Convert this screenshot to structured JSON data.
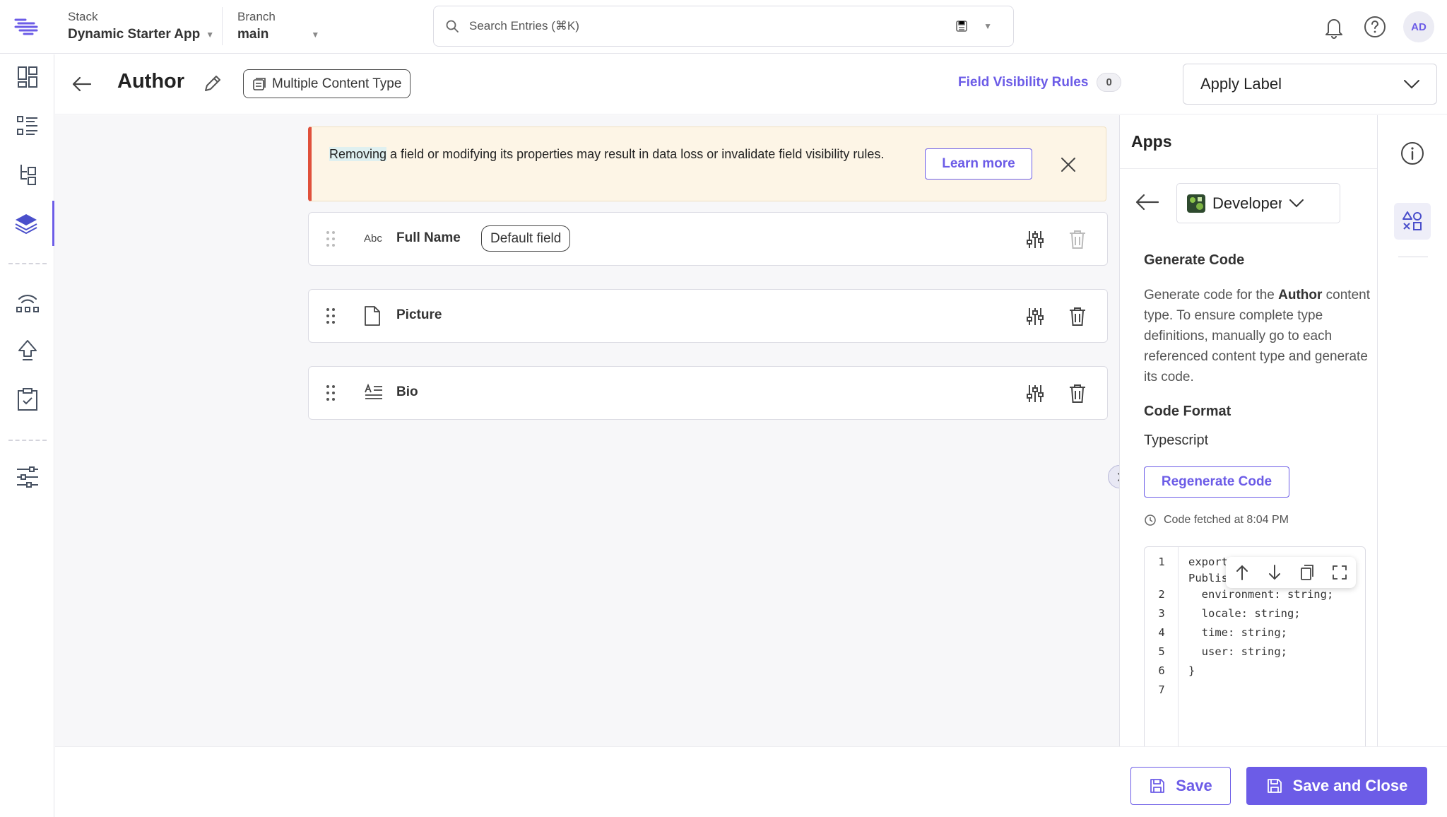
{
  "topbar": {
    "stack_label": "Stack",
    "stack_value": "Dynamic Starter App",
    "branch_label": "Branch",
    "branch_value": "main",
    "search_placeholder": "Search Entries (⌘K)",
    "avatar_initials": "AD"
  },
  "leftnav": {
    "items": [
      "dashboard-icon",
      "entries-icon",
      "content-models-icon",
      "content-types-icon",
      "releases-icon",
      "deploy-icon",
      "tasks-icon",
      "settings-icon"
    ],
    "active_item": "content-types-icon"
  },
  "header": {
    "title": "Author",
    "content_type_chip": "Multiple Content Type",
    "field_visibility_label": "Field Visibility Rules",
    "field_visibility_count": "0",
    "apply_label": "Apply Label"
  },
  "alert": {
    "highlighted_word": "Removing",
    "text": " a field or modifying its properties may result in data loss or invalidate field visibility rules.",
    "learn_more": "Learn more"
  },
  "fields": [
    {
      "icon_text": "Abc",
      "name": "Full Name",
      "chip": "Default field"
    },
    {
      "name": "Picture"
    },
    {
      "name": "Bio"
    }
  ],
  "apps_panel": {
    "title": "Apps",
    "app_select": "Developer",
    "generate_title": "Generate Code",
    "desc_pre": "Generate code for the ",
    "desc_bold": "Author",
    "desc_post": " content type. To ensure complete type definitions, manually go to each referenced content type and generate its code.",
    "code_format_title": "Code Format",
    "code_format_value": "Typescript",
    "regenerate_button": "Regenerate Code",
    "fetched_text": "Code fetched at 8:04 PM",
    "code_line_numbers": [
      "1",
      "2",
      "3",
      "4",
      "5",
      "6",
      "7"
    ],
    "code_lines": [
      "export ⠀⠀⠀⠀⠀",
      "Publis",
      "  environment: string;",
      "  locale: string;",
      "  time: string;",
      "  user: string;",
      "}"
    ]
  },
  "footer": {
    "save": "Save",
    "save_close": "Save and Close"
  },
  "colors": {
    "accent": "#6c5ce7",
    "alert_border": "#e0503b",
    "alert_bg": "#fdf5e6"
  }
}
